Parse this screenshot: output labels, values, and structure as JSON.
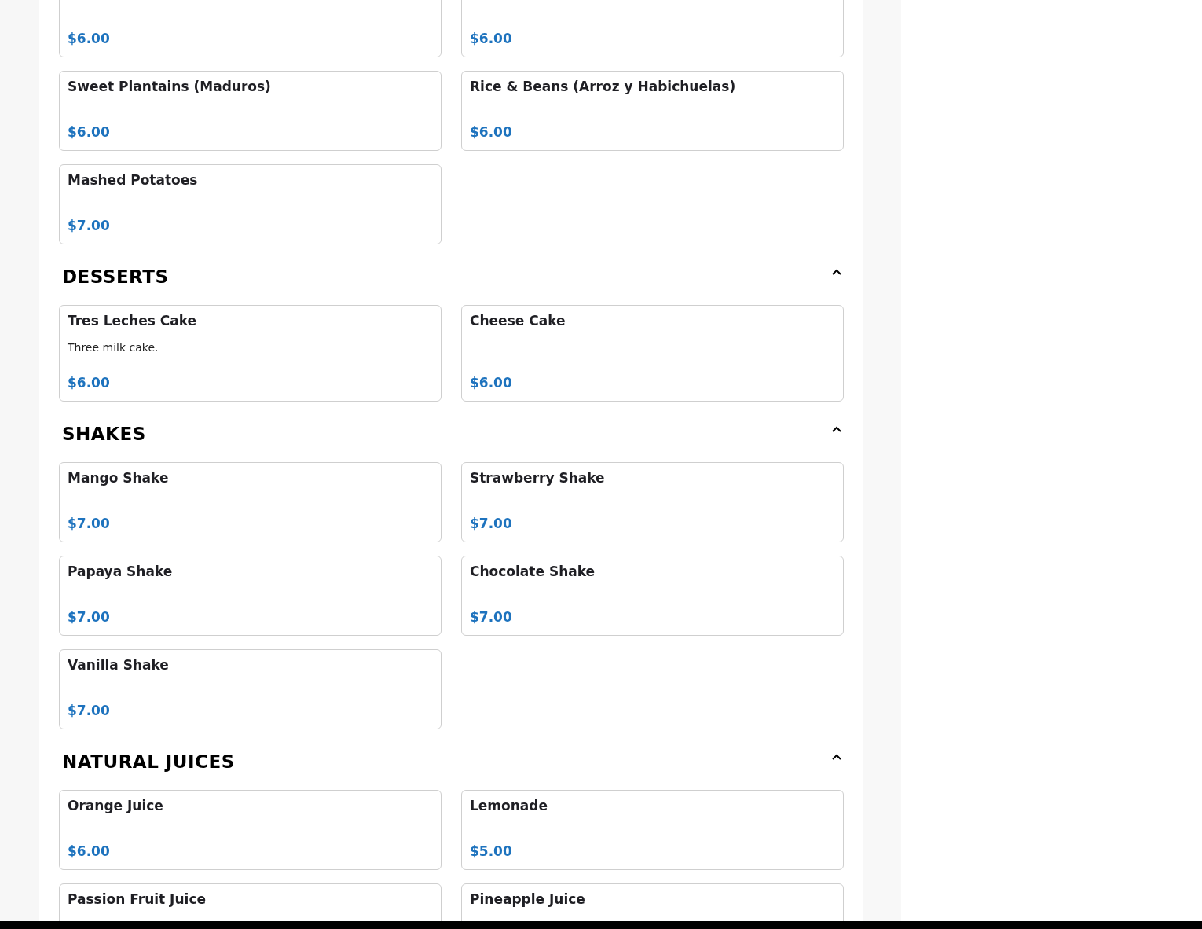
{
  "sections": [
    {
      "items": [
        {
          "price": "$6.00"
        },
        {
          "price": "$6.00"
        },
        {
          "name": "Sweet Plantains (Maduros)",
          "price": "$6.00"
        },
        {
          "name": "Rice & Beans (Arroz y Habichuelas)",
          "price": "$6.00"
        },
        {
          "name": "Mashed Potatoes",
          "price": "$7.00"
        }
      ]
    },
    {
      "title": "DESSERTS",
      "expanded": true,
      "items": [
        {
          "name": "Tres Leches Cake",
          "description": "Three milk cake.",
          "price": "$6.00"
        },
        {
          "name": "Cheese Cake",
          "price": "$6.00"
        }
      ]
    },
    {
      "title": "SHAKES",
      "expanded": true,
      "items": [
        {
          "name": "Mango Shake",
          "price": "$7.00"
        },
        {
          "name": "Strawberry Shake",
          "price": "$7.00"
        },
        {
          "name": "Papaya Shake",
          "price": "$7.00"
        },
        {
          "name": "Chocolate Shake",
          "price": "$7.00"
        },
        {
          "name": "Vanilla Shake",
          "price": "$7.00"
        }
      ]
    },
    {
      "title": "NATURAL JUICES",
      "expanded": true,
      "items": [
        {
          "name": "Orange Juice",
          "price": "$6.00"
        },
        {
          "name": "Lemonade",
          "price": "$5.00"
        },
        {
          "name": "Passion Fruit Juice"
        },
        {
          "name": "Pineapple Juice"
        }
      ]
    }
  ]
}
